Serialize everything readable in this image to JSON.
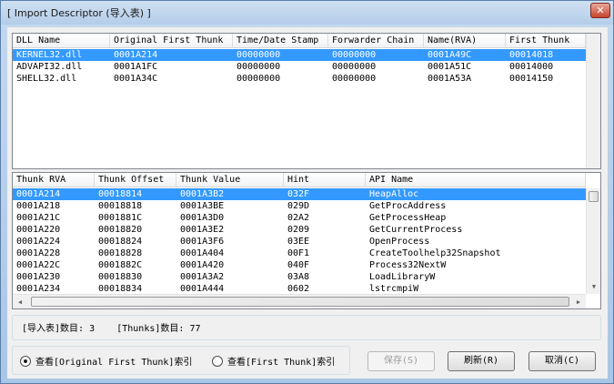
{
  "window": {
    "title": "[ Import Descriptor (导入表) ]",
    "close_glyph": "✕"
  },
  "dll_table": {
    "columns": [
      "DLL Name",
      "Original First Thunk",
      "Time/Date Stamp",
      "Forwarder Chain",
      "Name(RVA)",
      "First Thunk"
    ],
    "rows": [
      [
        "KERNEL32.dll",
        "0001A214",
        "00000000",
        "00000000",
        "0001A49C",
        "00014018"
      ],
      [
        "ADVAPI32.dll",
        "0001A1FC",
        "00000000",
        "00000000",
        "0001A51C",
        "00014000"
      ],
      [
        "SHELL32.dll",
        "0001A34C",
        "00000000",
        "00000000",
        "0001A53A",
        "00014150"
      ]
    ],
    "selected_row": 0
  },
  "thunk_table": {
    "columns": [
      "Thunk RVA",
      "Thunk Offset",
      "Thunk Value",
      "Hint",
      "API Name"
    ],
    "rows": [
      [
        "0001A214",
        "00018814",
        "0001A3B2",
        "032F",
        "HeapAlloc"
      ],
      [
        "0001A218",
        "00018818",
        "0001A3BE",
        "029D",
        "GetProcAddress"
      ],
      [
        "0001A21C",
        "0001881C",
        "0001A3D0",
        "02A2",
        "GetProcessHeap"
      ],
      [
        "0001A220",
        "00018820",
        "0001A3E2",
        "0209",
        "GetCurrentProcess"
      ],
      [
        "0001A224",
        "00018824",
        "0001A3F6",
        "03EE",
        "OpenProcess"
      ],
      [
        "0001A228",
        "00018828",
        "0001A404",
        "00F1",
        "CreateToolhelp32Snapshot"
      ],
      [
        "0001A22C",
        "0001882C",
        "0001A420",
        "040F",
        "Process32NextW"
      ],
      [
        "0001A230",
        "00018830",
        "0001A3A2",
        "03A8",
        "LoadLibraryW"
      ],
      [
        "0001A234",
        "00018834",
        "0001A444",
        "0602",
        "lstrcmpiW"
      ]
    ],
    "selected_row": 0
  },
  "status": {
    "import_label": "[导入表]数目:",
    "import_count": "3",
    "thunks_label": "[Thunks]数目:",
    "thunks_count": "77"
  },
  "options": {
    "radio_oft": "查看[Original First Thunk]索引",
    "radio_ft": "查看[First Thunk]索引",
    "selected": "oft"
  },
  "buttons": {
    "save": "保存(S)",
    "refresh": "刷新(R)",
    "cancel": "取消(C)"
  },
  "icons": {
    "up": "up-arrow-icon",
    "down": "down-arrow-icon",
    "left": "left-arrow-icon",
    "right": "right-arrow-icon"
  }
}
